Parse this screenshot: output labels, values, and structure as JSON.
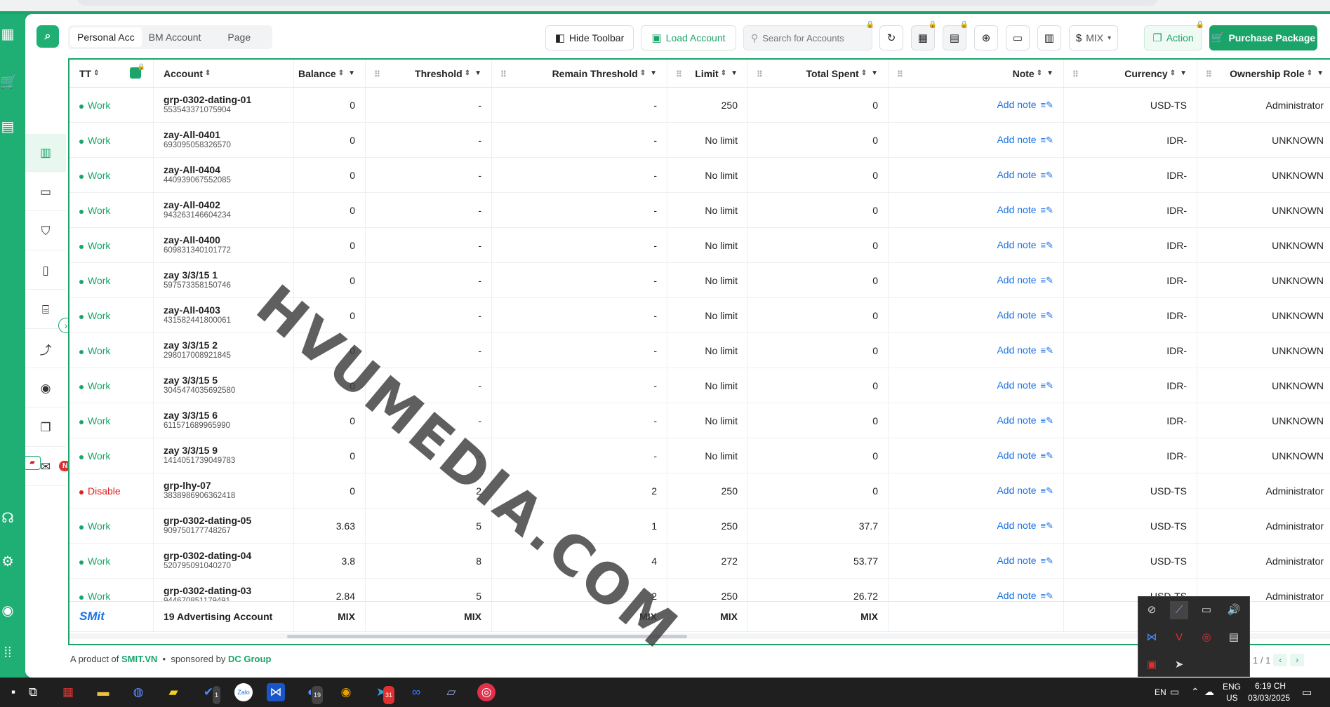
{
  "header": {
    "tabs": [
      {
        "label": "Personal Acc",
        "active": true
      },
      {
        "label": "BM Account",
        "active": false
      },
      {
        "label": "Page",
        "active": false
      }
    ],
    "hide_toolbar_label": "Hide Toolbar",
    "load_account_label": "Load Account",
    "search_placeholder": "Search for Accounts",
    "currency_label": "MIX",
    "action_label": "Action",
    "purchase_label": "Purchase Package"
  },
  "table": {
    "columns": [
      {
        "label": "TT"
      },
      {
        "label": "Account"
      },
      {
        "label": "Balance"
      },
      {
        "label": "Threshold"
      },
      {
        "label": "Remain Threshold"
      },
      {
        "label": "Limit"
      },
      {
        "label": "Total Spent"
      },
      {
        "label": "Note"
      },
      {
        "label": "Currency"
      },
      {
        "label": "Ownership Role"
      }
    ],
    "rows": [
      {
        "status": "Work",
        "name": "grp-0302-dating-01",
        "id": "553543371075904",
        "balance": "0",
        "threshold": "-",
        "remain": "-",
        "limit": "250",
        "spent": "0",
        "note": "Add note",
        "currency": "USD-TS",
        "role": "Administrator"
      },
      {
        "status": "Work",
        "name": "zay-All-0401",
        "id": "693095058326570",
        "balance": "0",
        "threshold": "-",
        "remain": "-",
        "limit": "No limit",
        "spent": "0",
        "note": "Add note",
        "currency": "IDR-",
        "role": "UNKNOWN"
      },
      {
        "status": "Work",
        "name": "zay-All-0404",
        "id": "440939067552085",
        "balance": "0",
        "threshold": "-",
        "remain": "-",
        "limit": "No limit",
        "spent": "0",
        "note": "Add note",
        "currency": "IDR-",
        "role": "UNKNOWN"
      },
      {
        "status": "Work",
        "name": "zay-All-0402",
        "id": "943263146604234",
        "balance": "0",
        "threshold": "-",
        "remain": "-",
        "limit": "No limit",
        "spent": "0",
        "note": "Add note",
        "currency": "IDR-",
        "role": "UNKNOWN"
      },
      {
        "status": "Work",
        "name": "zay-All-0400",
        "id": "609831340101772",
        "balance": "0",
        "threshold": "-",
        "remain": "-",
        "limit": "No limit",
        "spent": "0",
        "note": "Add note",
        "currency": "IDR-",
        "role": "UNKNOWN"
      },
      {
        "status": "Work",
        "name": "zay 3/3/15 1",
        "id": "597573358150746",
        "balance": "0",
        "threshold": "-",
        "remain": "-",
        "limit": "No limit",
        "spent": "0",
        "note": "Add note",
        "currency": "IDR-",
        "role": "UNKNOWN"
      },
      {
        "status": "Work",
        "name": "zay-All-0403",
        "id": "431582441800061",
        "balance": "0",
        "threshold": "-",
        "remain": "-",
        "limit": "No limit",
        "spent": "0",
        "note": "Add note",
        "currency": "IDR-",
        "role": "UNKNOWN"
      },
      {
        "status": "Work",
        "name": "zay 3/3/15 2",
        "id": "298017008921845",
        "balance": "0",
        "threshold": "-",
        "remain": "-",
        "limit": "No limit",
        "spent": "0",
        "note": "Add note",
        "currency": "IDR-",
        "role": "UNKNOWN"
      },
      {
        "status": "Work",
        "name": "zay 3/3/15 5",
        "id": "3045474035692580",
        "balance": "0",
        "threshold": "-",
        "remain": "-",
        "limit": "No limit",
        "spent": "0",
        "note": "Add note",
        "currency": "IDR-",
        "role": "UNKNOWN"
      },
      {
        "status": "Work",
        "name": "zay 3/3/15 6",
        "id": "611571689965990",
        "balance": "0",
        "threshold": "-",
        "remain": "-",
        "limit": "No limit",
        "spent": "0",
        "note": "Add note",
        "currency": "IDR-",
        "role": "UNKNOWN"
      },
      {
        "status": "Work",
        "name": "zay 3/3/15 9",
        "id": "1414051739049783",
        "balance": "0",
        "threshold": "-",
        "remain": "-",
        "limit": "No limit",
        "spent": "0",
        "note": "Add note",
        "currency": "IDR-",
        "role": "UNKNOWN"
      },
      {
        "status": "Disable",
        "name": "grp-lhy-07",
        "id": "3838986906362418",
        "balance": "0",
        "threshold": "2",
        "remain": "2",
        "limit": "250",
        "spent": "0",
        "note": "Add note",
        "currency": "USD-TS",
        "role": "Administrator"
      },
      {
        "status": "Work",
        "name": "grp-0302-dating-05",
        "id": "909750177748267",
        "balance": "3.63",
        "threshold": "5",
        "remain": "1",
        "limit": "250",
        "spent": "37.7",
        "note": "Add note",
        "currency": "USD-TS",
        "role": "Administrator"
      },
      {
        "status": "Work",
        "name": "grp-0302-dating-04",
        "id": "520795091040270",
        "balance": "3.8",
        "threshold": "8",
        "remain": "4",
        "limit": "272",
        "spent": "53.77",
        "note": "Add note",
        "currency": "USD-TS",
        "role": "Administrator"
      },
      {
        "status": "Work",
        "name": "grp-0302-dating-03",
        "id": "944670851179491",
        "balance": "2.84",
        "threshold": "5",
        "remain": "2",
        "limit": "250",
        "spent": "26.72",
        "note": "Add note",
        "currency": "USD-TS",
        "role": "Administrator"
      }
    ],
    "totals": {
      "brand": "SMit",
      "accounts": "19 Advertising Account",
      "balance": "MIX",
      "threshold": "MIX",
      "remain": "MIX",
      "limit": "MIX",
      "spent": "MIX"
    }
  },
  "watermark": "HVUMEDIA.COM",
  "footer": {
    "product_prefix": "A product of",
    "product_name": "SMIT.VN",
    "sponsor_prefix": "sponsored by",
    "sponsor_name": "DC Group",
    "pagination": "1 / 1"
  },
  "taskbar": {
    "lang_code": "EN",
    "keyboard_line1": "ENG",
    "keyboard_line2": "US",
    "time": "6:19 CH",
    "date": "03/03/2025",
    "telegram_badge": "31",
    "task_badge": "1",
    "badge_19": "19"
  },
  "sidenav": {
    "new_badge": "N"
  },
  "colors": {
    "accent": "#1aa46a",
    "link": "#1a73e8",
    "danger": "#e02020",
    "lock": "#e8a200"
  }
}
